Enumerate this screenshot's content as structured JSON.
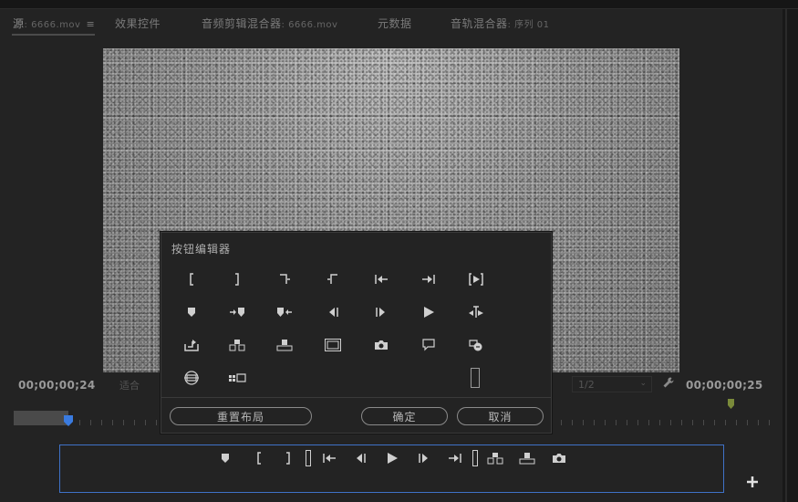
{
  "tabs": [
    {
      "label": "源",
      "sub": ": 6666.mov",
      "active": true
    },
    {
      "label": "效果控件",
      "sub": "",
      "active": false
    },
    {
      "label": "音频剪辑混合器",
      "sub": ": 6666.mov",
      "active": false
    },
    {
      "label": "元数据",
      "sub": "",
      "active": false
    },
    {
      "label": "音轨混合器",
      "sub": ": 序列 01",
      "active": false
    }
  ],
  "tab_menu_glyph": "≡",
  "timecode_left": "00;00;00;24",
  "timecode_right": "00;00;00;25",
  "fit_value": "适合",
  "resolution_value": "1/2",
  "dialog": {
    "title": "按钮编辑器",
    "reset_label": "重置布局",
    "ok_label": "确定",
    "cancel_label": "取消"
  },
  "colors": {
    "accent": "#3f72c8",
    "playhead": "#3a7be0",
    "marker": "#7a8a3a"
  }
}
